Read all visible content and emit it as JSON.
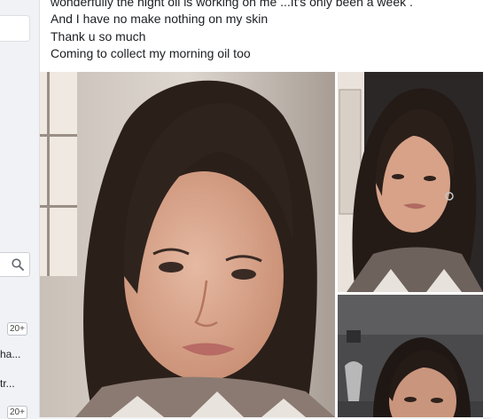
{
  "post": {
    "lines": [
      "wonderfully the night oil is working on me ...It's only been a week .",
      "And I have no make nothing on my skin",
      "Thank u so much",
      "Coming to collect my morning oil too"
    ],
    "photos": [
      {
        "label": "selfie-photo-main"
      },
      {
        "label": "selfie-photo-top-right"
      },
      {
        "label": "selfie-photo-bottom-right"
      }
    ]
  },
  "sidebar": {
    "badges": [
      "20+",
      "20+"
    ],
    "items": [
      "ha...",
      "tr..."
    ],
    "search_icon": "search-icon"
  }
}
